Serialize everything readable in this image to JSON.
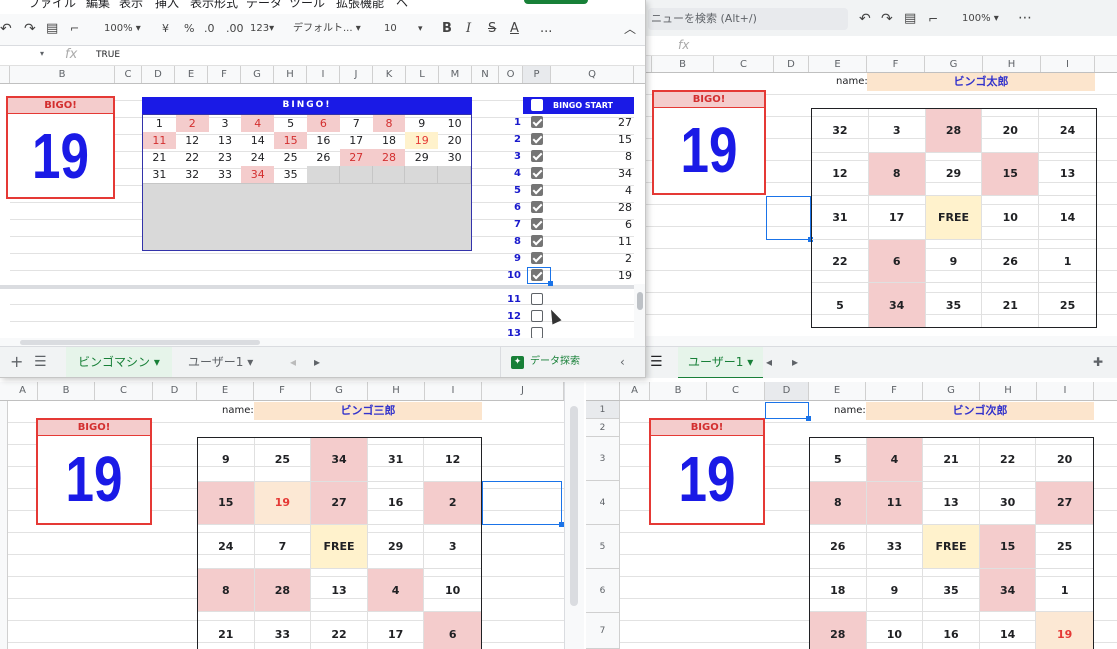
{
  "menu": [
    "ファイル",
    "編集",
    "表示",
    "挿入",
    "表示形式",
    "データ",
    "ツール",
    "拡張機能",
    "ヘ"
  ],
  "toolbar": {
    "zoom": "100%",
    "yen": "¥",
    "percent": "%",
    "dec0": ".0",
    "dec00": ".00",
    "fmt": "123▾",
    "font": "デフォルト...",
    "size": "10",
    "bold": "B",
    "italic": "I",
    "strike": "S",
    "color": "A",
    "more": "..."
  },
  "formula": {
    "fx": "fx",
    "value": "TRUE"
  },
  "search_placeholder": "ニューを検索 (Alt+/)",
  "right_toolbar": {
    "zoom": "100%"
  },
  "colors": {
    "accent": "#1a1ae6",
    "hit": "#f4cccc",
    "free": "#fff2cc",
    "name_bg": "#fce5cd",
    "border_red": "#e53935",
    "sheets_green": "#188038"
  },
  "main": {
    "cols": [
      "B",
      "C",
      "D",
      "E",
      "F",
      "G",
      "H",
      "I",
      "J",
      "K",
      "L",
      "M",
      "N",
      "O",
      "P",
      "Q"
    ],
    "bigo_label": "BIGO!",
    "current_number": "19",
    "bingo_title": "BINGO!",
    "bingo_numbers": [
      [
        "1",
        "2",
        "3",
        "4",
        "5",
        "6",
        "7",
        "8",
        "9",
        "10"
      ],
      [
        "11",
        "12",
        "13",
        "14",
        "15",
        "16",
        "17",
        "18",
        "19",
        "20"
      ],
      [
        "21",
        "22",
        "23",
        "24",
        "25",
        "26",
        "27",
        "28",
        "29",
        "30"
      ],
      [
        "31",
        "32",
        "33",
        "34",
        "35",
        "",
        "",
        "",
        "",
        ""
      ]
    ],
    "start_label": "BINGO START",
    "draws": [
      {
        "n": "1",
        "v": "27",
        "checked": true
      },
      {
        "n": "2",
        "v": "15",
        "checked": true
      },
      {
        "n": "3",
        "v": "8",
        "checked": true
      },
      {
        "n": "4",
        "v": "34",
        "checked": true
      },
      {
        "n": "5",
        "v": "4",
        "checked": true
      },
      {
        "n": "6",
        "v": "28",
        "checked": true
      },
      {
        "n": "7",
        "v": "6",
        "checked": true
      },
      {
        "n": "8",
        "v": "11",
        "checked": true
      },
      {
        "n": "9",
        "v": "2",
        "checked": true
      },
      {
        "n": "10",
        "v": "19",
        "checked": true
      },
      {
        "n": "11",
        "v": "",
        "checked": false
      },
      {
        "n": "12",
        "v": "",
        "checked": false
      },
      {
        "n": "13",
        "v": "",
        "checked": false
      }
    ],
    "tabs": [
      {
        "label": "ビンゴマシン",
        "active": true
      },
      {
        "label": "ユーザー1",
        "active": false
      }
    ],
    "explore": "データ探索"
  },
  "card_taro": {
    "cols": [
      "B",
      "C",
      "D",
      "E",
      "F",
      "G",
      "H",
      "I"
    ],
    "name_label": "name:",
    "name": "ビンゴ太郎",
    "bigo_label": "BIGO!",
    "current_number": "19",
    "cells": [
      [
        "32",
        "3",
        "28",
        "20",
        "24"
      ],
      [
        "12",
        "8",
        "29",
        "15",
        "13"
      ],
      [
        "31",
        "17",
        "FREE",
        "10",
        "14"
      ],
      [
        "22",
        "6",
        "9",
        "26",
        "1"
      ],
      [
        "5",
        "34",
        "35",
        "21",
        "25"
      ]
    ],
    "tab": "ユーザー1"
  },
  "card_saburo": {
    "cols": [
      "A",
      "B",
      "C",
      "D",
      "E",
      "F",
      "G",
      "H",
      "I",
      "J"
    ],
    "name_label": "name:",
    "name": "ビンゴ三郎",
    "bigo_label": "BIGO!",
    "current_number": "19",
    "cells": [
      [
        "9",
        "25",
        "34",
        "31",
        "12"
      ],
      [
        "15",
        "19",
        "27",
        "16",
        "2"
      ],
      [
        "24",
        "7",
        "FREE",
        "29",
        "3"
      ],
      [
        "8",
        "28",
        "13",
        "4",
        "10"
      ],
      [
        "21",
        "33",
        "22",
        "17",
        "6"
      ]
    ]
  },
  "card_jiro": {
    "cols": [
      "A",
      "B",
      "C",
      "D",
      "E",
      "F",
      "G",
      "H",
      "I"
    ],
    "rows": [
      "1",
      "2",
      "3",
      "4",
      "5",
      "6",
      "7"
    ],
    "name_label": "name:",
    "name": "ビンゴ次郎",
    "bigo_label": "BIGO!",
    "current_number": "19",
    "cells": [
      [
        "5",
        "4",
        "21",
        "22",
        "20"
      ],
      [
        "8",
        "11",
        "13",
        "30",
        "27"
      ],
      [
        "26",
        "33",
        "FREE",
        "15",
        "25"
      ],
      [
        "18",
        "9",
        "35",
        "34",
        "1"
      ],
      [
        "28",
        "10",
        "16",
        "14",
        "19"
      ]
    ]
  }
}
